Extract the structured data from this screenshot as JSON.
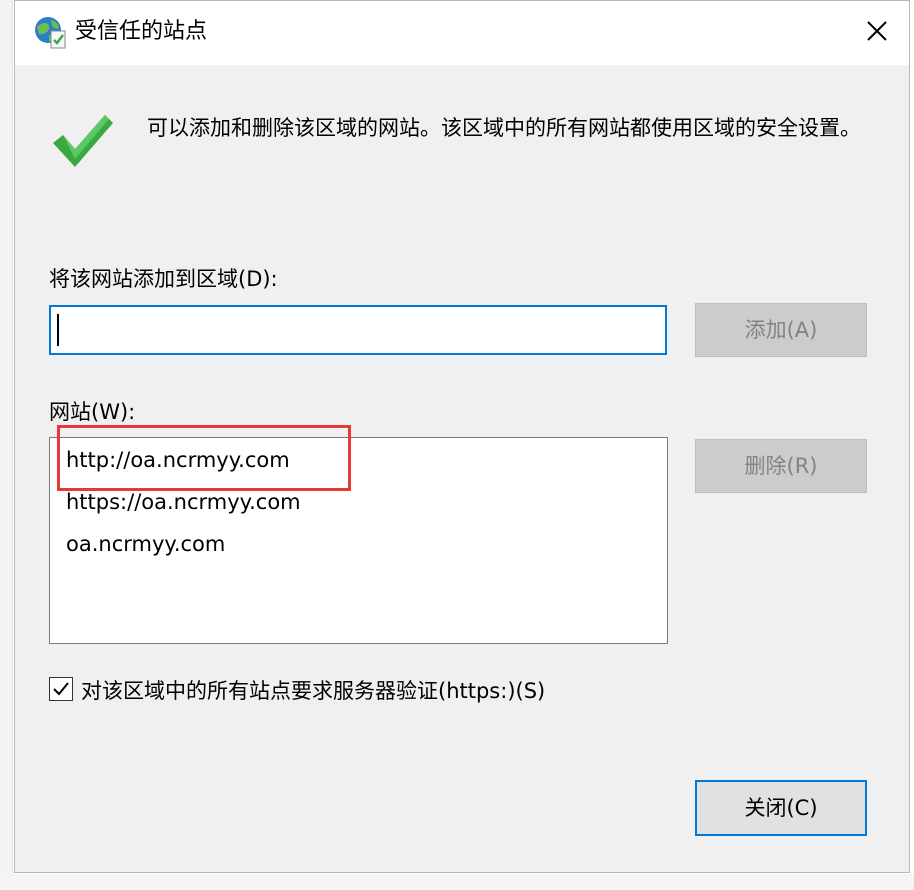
{
  "dialog": {
    "title": "受信任的站点",
    "close_glyph": "✕"
  },
  "description": "可以添加和删除该区域的网站。该区域中的所有网站都使用区域的安全设置。",
  "add_section": {
    "label": "将该网站添加到区域(D):",
    "input_value": "",
    "add_button": "添加(A)"
  },
  "sites_section": {
    "label": "网站(W):",
    "items": [
      "http://oa.ncrmyy.com",
      "https://oa.ncrmyy.com",
      "oa.ncrmyy.com"
    ],
    "remove_button": "删除(R)"
  },
  "require_https": {
    "checked": true,
    "label": "对该区域中的所有站点要求服务器验证(https:)(S)"
  },
  "close_button": "关闭(C)",
  "icons": {
    "title": "trusted-sites-globe-icon",
    "info": "green-checkmark-icon"
  },
  "colors": {
    "focus_border": "#0078d7",
    "annotation_red": "#e53935",
    "check_green": "#3aa843"
  }
}
